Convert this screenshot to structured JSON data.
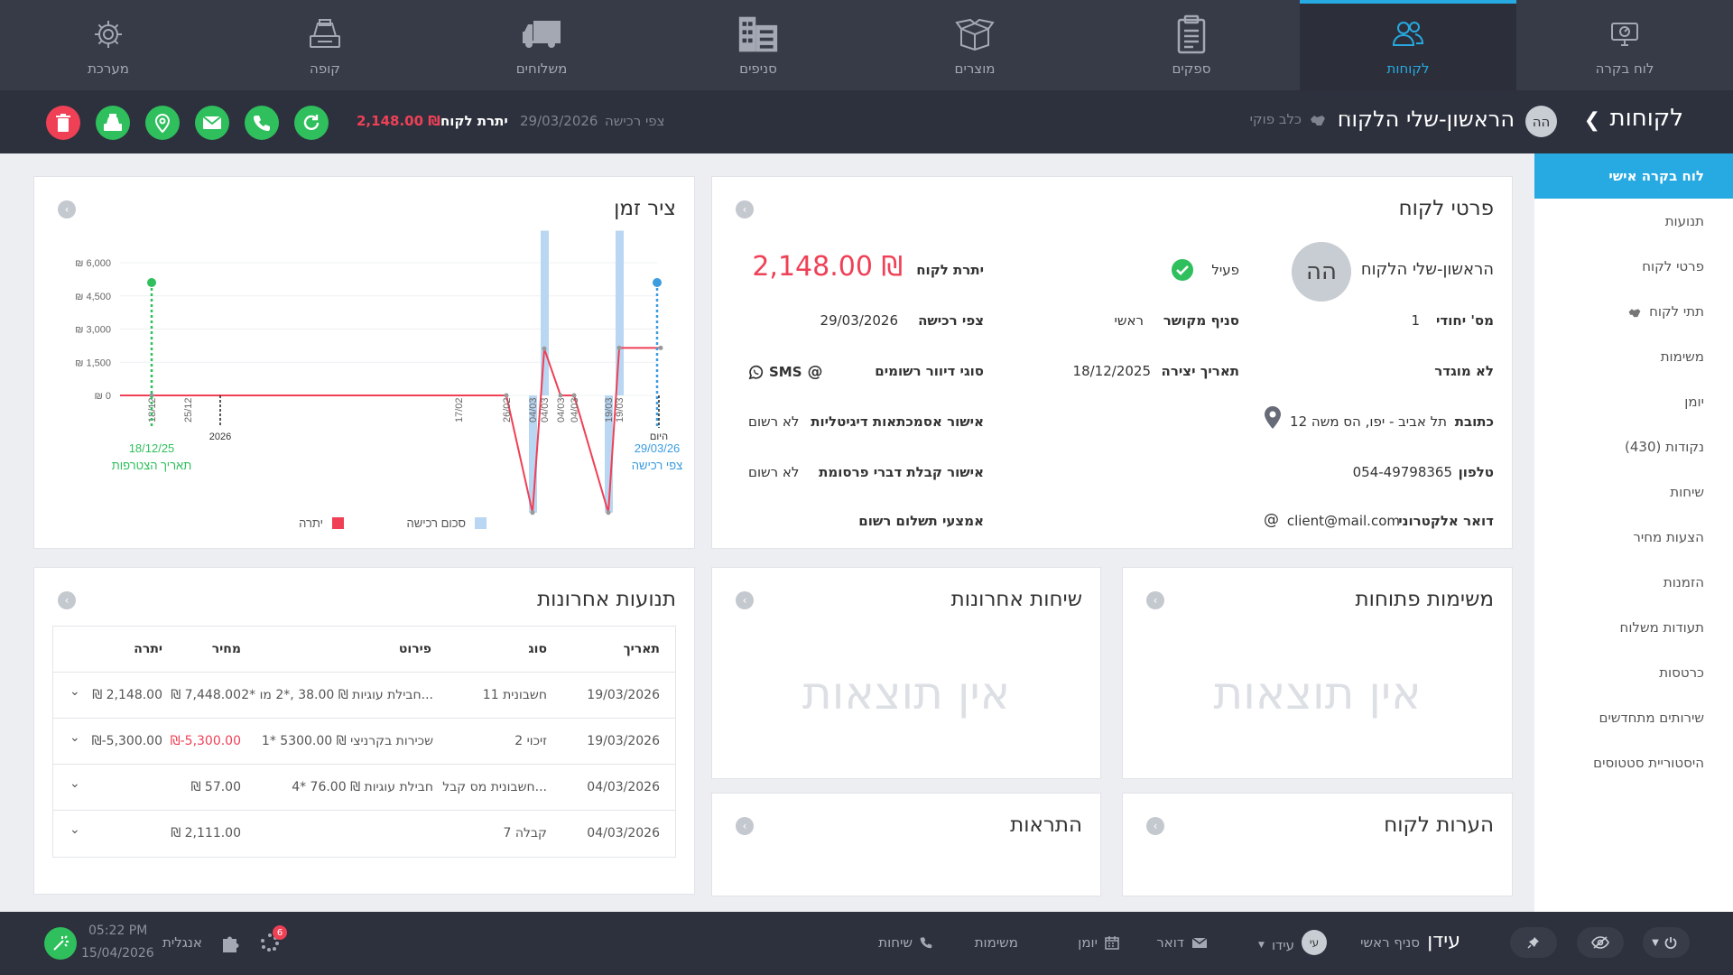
{
  "nav": {
    "items": [
      {
        "label": "לוח בקרה",
        "icon": "dashboard-icon"
      },
      {
        "label": "לקוחות",
        "icon": "customers-icon"
      },
      {
        "label": "ספקים",
        "icon": "suppliers-icon"
      },
      {
        "label": "מוצרים",
        "icon": "products-icon"
      },
      {
        "label": "סניפים",
        "icon": "branches-icon"
      },
      {
        "label": "משלוחים",
        "icon": "shipping-icon"
      },
      {
        "label": "קופה",
        "icon": "register-icon"
      },
      {
        "label": "מערכת",
        "icon": "settings-icon"
      }
    ],
    "active_index": 1
  },
  "subbar": {
    "section": "לקוחות",
    "avatar": "הה",
    "customer_name": "הראשון-שלי הלקוח",
    "dash": "--",
    "pet": "כלב פוקי",
    "expected_label": "צפי רכישה",
    "expected_date": "29/03/2026",
    "balance_label": "יתרת לקוח",
    "balance_value": "2,148.00 ₪",
    "colors": {
      "delete": "#ef4056",
      "action": "#2fbf5d"
    }
  },
  "side_menu": [
    "לוח בקרה אישי",
    "תנועות",
    "פרטי לקוח",
    "תתי לקוח",
    "משימות",
    "יומן",
    "נקודות (430)",
    "שיחות",
    "הצעות מחיר",
    "הזמנות",
    "תעודות משלוח",
    "כרטסות",
    "שירותים מתחדשים",
    "היסטוריית סטטוסים"
  ],
  "details": {
    "title": "פרטי לקוח",
    "avatar": "הה",
    "name": "הראשון-שלי הלקוח",
    "status": "פעיל",
    "balance_label": "יתרת לקוח",
    "balance_value": "2,148.00 ₪",
    "id_label": "מס' יחודי",
    "id_value": "1",
    "branch_label": "סניף מקושר",
    "branch_value": "ראשי",
    "expected_label": "צפי רכישה",
    "expected_value": "29/03/2026",
    "group": "לא מוגדר",
    "created_label": "תאריך יצירה",
    "created_value": "18/12/2025",
    "mail_types_label": "סוגי דיוור רשומים",
    "sms": "SMS",
    "address_label": "כתובת",
    "address_value": "תל אביב - יפו, הס משה 12",
    "digital_label": "אישור אסמכתאות דיגיטליות",
    "digital_value": "לא רשום",
    "phone_label": "טלפון",
    "phone_value": "054-49798365",
    "ads_label": "אישור קבלת דברי פרסומת",
    "ads_value": "לא רשום",
    "email_label": "דואר אלקטרוני",
    "email_value": "client@mail.com",
    "payment_label": "אמצעי תשלום רשום"
  },
  "timeline": {
    "title": "ציר זמן",
    "start_date": "18/12/25",
    "start_label": "תאריך הצטרפות",
    "end_date": "29/03/26",
    "end_label": "צפי רכישה",
    "today_label": "היום",
    "year_label": "2026"
  },
  "chart_data": {
    "type": "line",
    "title": "",
    "y_ticks": [
      "₪ 6,000",
      "₪ 4,500",
      "₪ 3,000",
      "₪ 1,500",
      "₪ 0"
    ],
    "ylim": [
      -5300,
      7448
    ],
    "x_ticks": [
      "18/12",
      "25/12",
      "17/02",
      "26/02",
      "04/03",
      "04/03",
      "04/03",
      "04/03",
      "19/03",
      "19/03"
    ],
    "series": [
      {
        "name": "יתרה",
        "color": "#ef4056",
        "x": [
          "18/12",
          "26/02",
          "04/03",
          "04/03",
          "04/03",
          "04/03",
          "19/03",
          "19/03",
          "today"
        ],
        "values": [
          0,
          0,
          -5300,
          2111,
          0,
          0,
          -5300,
          2148,
          2148
        ]
      },
      {
        "name": "סכום רכישה",
        "color": "#b9d6f2",
        "x": [
          "04/03",
          "04/03",
          "19/03",
          "19/03"
        ],
        "values": [
          -5300,
          7448,
          7448,
          -5300
        ]
      }
    ],
    "legend": [
      "יתרה",
      "סכום רכישה"
    ]
  },
  "transactions": {
    "title": "תנועות אחרונות",
    "headers": {
      "date": "תאריך",
      "type": "סוג",
      "details": "פירוט",
      "price": "מחיר",
      "balance": "יתרה"
    },
    "rows": [
      {
        "date": "19/03/2026",
        "type": "חשבונית 11",
        "details": "2* חבילת עוגיות ₪ 38.00 ,*2 מו...",
        "price": "₪ 7,448.00",
        "balance": "₪ 2,148.00",
        "neg": false
      },
      {
        "date": "19/03/2026",
        "type": "זיכוי 2",
        "details": "1* שכירות בקרניצי ₪ 5300.00",
        "price": "₪-5,300.00",
        "balance": "₪-5,300.00",
        "neg": true
      },
      {
        "date": "04/03/2026",
        "type": "חשבונית מס קבל...",
        "details": "4* חבילת עוגיות ₪ 76.00",
        "price": "₪ 57.00",
        "balance": "",
        "neg": false
      },
      {
        "date": "04/03/2026",
        "type": "קבלה 7",
        "details": "",
        "price": "₪ 2,111.00",
        "balance": "",
        "neg": false
      }
    ]
  },
  "calls": {
    "title": "שיחות אחרונות",
    "empty": "אין תוצאות"
  },
  "tasks": {
    "title": "משימות פתוחות",
    "empty": "אין תוצאות"
  },
  "alerts": {
    "title": "התראות"
  },
  "notes": {
    "title": "הערות לקוח"
  },
  "bottom": {
    "brand": "עידן",
    "branch": "סניף ראשי",
    "user_avatar": "עי",
    "user": "עידו",
    "mail": "דואר",
    "calendar": "יומן",
    "tasks": "משימות",
    "calls": "שיחות",
    "time": "05:22 PM",
    "date": "15/04/2026",
    "lang": "אנגלית",
    "badge": "6"
  }
}
